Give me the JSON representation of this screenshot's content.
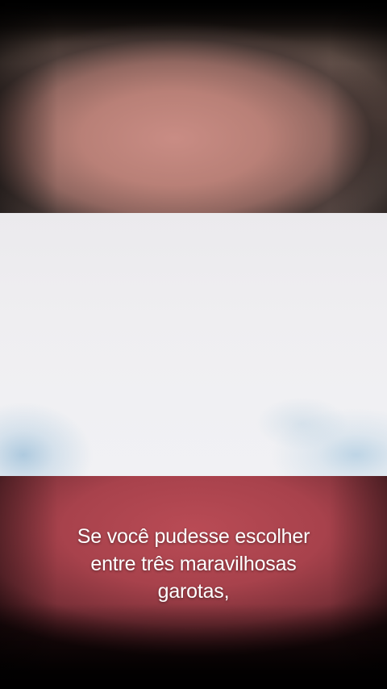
{
  "video": {
    "subtitle_lines": [
      "Se você pudesse escolher",
      "entre três maravilhosas",
      "garotas,"
    ]
  }
}
